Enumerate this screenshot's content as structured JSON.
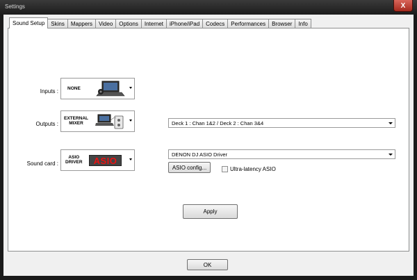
{
  "window": {
    "title": "Settings",
    "close_label": "X"
  },
  "tabs": [
    {
      "label": "Sound Setup",
      "active": true
    },
    {
      "label": "Skins"
    },
    {
      "label": "Mappers"
    },
    {
      "label": "Video"
    },
    {
      "label": "Options"
    },
    {
      "label": "Internet"
    },
    {
      "label": "iPhone/iPad"
    },
    {
      "label": "Codecs"
    },
    {
      "label": "Performances"
    },
    {
      "label": "Browser"
    },
    {
      "label": "Info"
    }
  ],
  "sound_setup": {
    "inputs": {
      "label": "Inputs :",
      "value": "NONE",
      "icon": "laptop-turntable-icon"
    },
    "outputs": {
      "label": "Outputs :",
      "value_line1": "EXTERNAL",
      "value_line2": "MIXER",
      "icon": "laptop-mixer-icon",
      "routing_value": "Deck 1 : Chan 1&2 / Deck 2 : Chan 3&4"
    },
    "sound_card": {
      "label": "Sound card :",
      "value_line1": "ASIO",
      "value_line2": "DRIVER",
      "logo_text": "ASIO",
      "driver_value": "DENON DJ ASIO Driver"
    },
    "asio_config_label": "ASIO config...",
    "ultra_latency_label": "Ultra-latency ASIO",
    "ultra_latency_checked": false,
    "apply_label": "Apply"
  },
  "footer": {
    "ok_label": "OK"
  }
}
